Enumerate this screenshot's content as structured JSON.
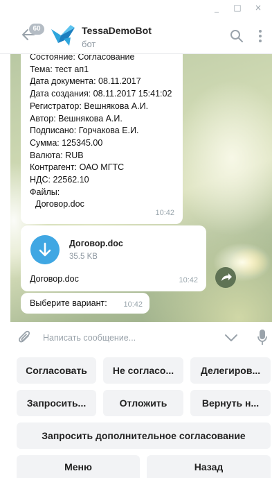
{
  "window": {
    "controls": [
      "_",
      "□",
      "×"
    ]
  },
  "header": {
    "unread_badge": "60",
    "title": "TessaDemoBot",
    "subtitle": "бот"
  },
  "messages": [
    {
      "lines": [
        "Состояние: Согласование",
        "Тема: тест ап1",
        "Дата документа: 08.11.2017",
        "Дата создания: 08.11.2017 15:41:02",
        "Регистратор: Вешнякова А.И.",
        "Автор: Вешнякова А.И.",
        "Подписано: Горчакова Е.И.",
        "Сумма: 125345.00",
        "Валюта: RUB",
        "Контрагент: ОАО МГТС",
        "НДС: 22562.10",
        "Файлы:"
      ],
      "file_line": "Договор.doc",
      "time": "10:42"
    },
    {
      "file_name": "Договор.doc",
      "file_size": "35.5 KB",
      "caption": "Договор.doc",
      "time": "10:42"
    },
    {
      "text": "Выберите вариант:",
      "time": "10:42"
    }
  ],
  "input": {
    "placeholder": "Написать сообщение..."
  },
  "keyboard": {
    "row1": [
      "Согласовать",
      "Не согласо...",
      "Делегиров..."
    ],
    "row2": [
      "Запросить...",
      "Отложить",
      "Вернуть н..."
    ],
    "row3": [
      "Запросить дополнительное согласование"
    ],
    "row4": [
      "Меню",
      "Назад"
    ]
  },
  "colors": {
    "accent": "#40a7e3",
    "bot_logo": "#2ea6dd",
    "button_bg": "#f2f3f5"
  }
}
